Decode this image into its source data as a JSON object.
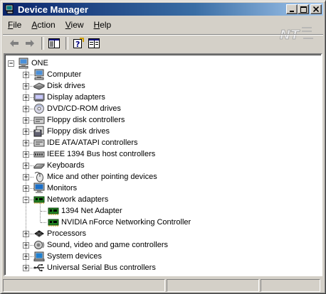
{
  "window": {
    "title": "Device Manager",
    "controls": [
      "minimize",
      "maximize",
      "close"
    ]
  },
  "menu": [
    {
      "label": "File",
      "accel": "F",
      "rest": "ile"
    },
    {
      "label": "Action",
      "accel": "A",
      "rest": "ction"
    },
    {
      "label": "View",
      "accel": "V",
      "rest": "iew"
    },
    {
      "label": "Help",
      "accel": "H",
      "rest": "elp"
    }
  ],
  "toolbar": [
    "back-arrow",
    "forward-arrow",
    "show-hide-console-tree",
    "help",
    "properties"
  ],
  "tree": {
    "root": {
      "label": "ONE",
      "icon": "computer-icon",
      "expanded": true
    },
    "items": [
      {
        "label": "Computer",
        "icon": "computer-icon",
        "expanded": false
      },
      {
        "label": "Disk drives",
        "icon": "disk-drive-icon",
        "expanded": false
      },
      {
        "label": "Display adapters",
        "icon": "display-adapter-icon",
        "expanded": false
      },
      {
        "label": "DVD/CD-ROM drives",
        "icon": "cdrom-icon",
        "expanded": false
      },
      {
        "label": "Floppy disk controllers",
        "icon": "controller-icon",
        "expanded": false
      },
      {
        "label": "Floppy disk drives",
        "icon": "floppy-drive-icon",
        "expanded": false
      },
      {
        "label": "IDE ATA/ATAPI controllers",
        "icon": "controller-icon",
        "expanded": false
      },
      {
        "label": "IEEE 1394 Bus host controllers",
        "icon": "bus-controller-icon",
        "expanded": false
      },
      {
        "label": "Keyboards",
        "icon": "keyboard-icon",
        "expanded": false
      },
      {
        "label": "Mice and other pointing devices",
        "icon": "mouse-icon",
        "expanded": false
      },
      {
        "label": "Monitors",
        "icon": "monitor-icon",
        "expanded": false
      },
      {
        "label": "Network adapters",
        "icon": "network-adapter-icon",
        "expanded": true,
        "children": [
          {
            "label": "1394 Net Adapter",
            "icon": "network-adapter-icon"
          },
          {
            "label": "NVIDIA nForce Networking Controller",
            "icon": "network-adapter-icon"
          }
        ]
      },
      {
        "label": "Processors",
        "icon": "processor-icon",
        "expanded": false
      },
      {
        "label": "Sound, video and game controllers",
        "icon": "sound-icon",
        "expanded": false
      },
      {
        "label": "System devices",
        "icon": "system-icon",
        "expanded": false
      },
      {
        "label": "Universal Serial Bus controllers",
        "icon": "usb-icon",
        "expanded": false
      }
    ]
  },
  "colors": {
    "title_gradient_start": "#0a246a",
    "title_gradient_end": "#a6caf0",
    "face": "#d4d0c8"
  }
}
